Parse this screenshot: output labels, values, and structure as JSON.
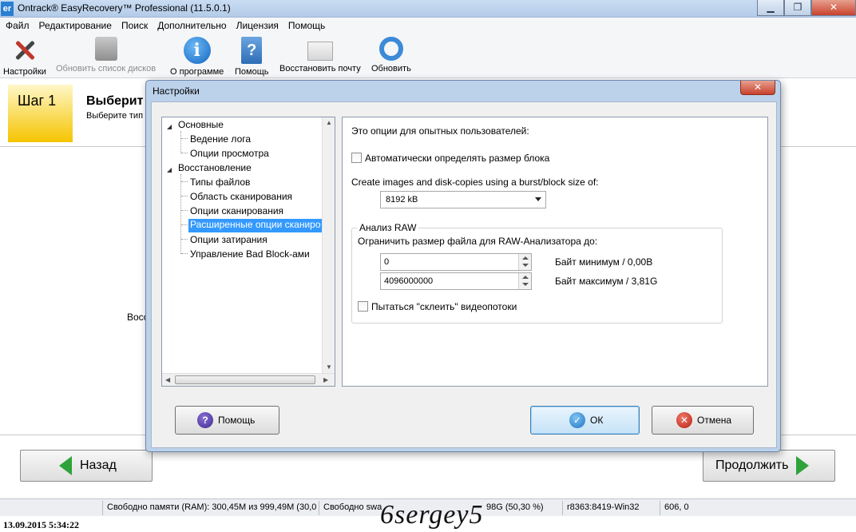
{
  "window": {
    "app_icon": "er",
    "title": "Ontrack® EasyRecovery™ Professional (11.5.0.1)",
    "minimize_icon": "minimize-icon",
    "maximize_icon": "maximize-icon",
    "close_icon": "close-icon"
  },
  "menu": {
    "items": [
      "Файл",
      "Редактирование",
      "Поиск",
      "Дополнительно",
      "Лицензия",
      "Помощь"
    ]
  },
  "toolbar": {
    "items": [
      {
        "label": "Настройки",
        "icon": "tools-icon",
        "enabled": true
      },
      {
        "label": "Обновить список дисков",
        "icon": "disk-icon",
        "enabled": false
      },
      {
        "label": "О программе",
        "icon": "info-icon",
        "enabled": true
      },
      {
        "label": "Помощь",
        "icon": "help-book-icon",
        "enabled": true
      },
      {
        "label": "Восстановить почту",
        "icon": "mail-icon",
        "enabled": true
      },
      {
        "label": "Обновить",
        "icon": "refresh-icon",
        "enabled": true
      }
    ]
  },
  "step": {
    "badge": "Шаг 1",
    "title": "Выберит",
    "subtitle": "Выберите тип"
  },
  "content": {
    "label": "Восс"
  },
  "nav": {
    "back_label": "Назад",
    "next_label": "Продолжить"
  },
  "statusbar": {
    "memory": "Свободно памяти (RAM): 300,45M из 999,49M (30,0",
    "swap": "Свободно swa",
    "disk": "98G (50,30 %)",
    "build": "r8363:8419-Win32",
    "coords": "606, 0"
  },
  "overlay": {
    "timestamp": "13.09.2015 5:34:22",
    "watermark": "6sergey5"
  },
  "dialog": {
    "title": "Настройки",
    "close_icon": "close-icon",
    "tree": {
      "groups": [
        {
          "label": "Основные",
          "children": [
            "Ведение лога",
            "Опции просмотра"
          ]
        },
        {
          "label": "Восстановление",
          "children": [
            "Типы файлов",
            "Область сканирования",
            "Опции сканирования",
            "Расширенные опции сканиро",
            "Опции затирания",
            "Управление Bad Block-ами"
          ]
        }
      ],
      "selected": "Расширенные опции сканиро"
    },
    "options": {
      "intro": "Это опции для опытных пользователей:",
      "auto_block_label": "Автоматически определять размер блока",
      "auto_block_checked": false,
      "burst_label": "Create images and disk-copies using a burst/block size of:",
      "burst_value": "8192 kB",
      "raw_group_title": "Анализ RAW",
      "raw_limit_label": "Ограничить размер файла для RAW-Анализатора до:",
      "min_value": "0",
      "min_label": "Байт минимум / 0,00B",
      "max_value": "4096000000",
      "max_label": "Байт максимум / 3,81G",
      "glue_label": "Пытаться \"склеить\" видеопотоки",
      "glue_checked": false
    },
    "buttons": {
      "help": "Помощь",
      "ok": "ОК",
      "cancel": "Отмена"
    }
  }
}
